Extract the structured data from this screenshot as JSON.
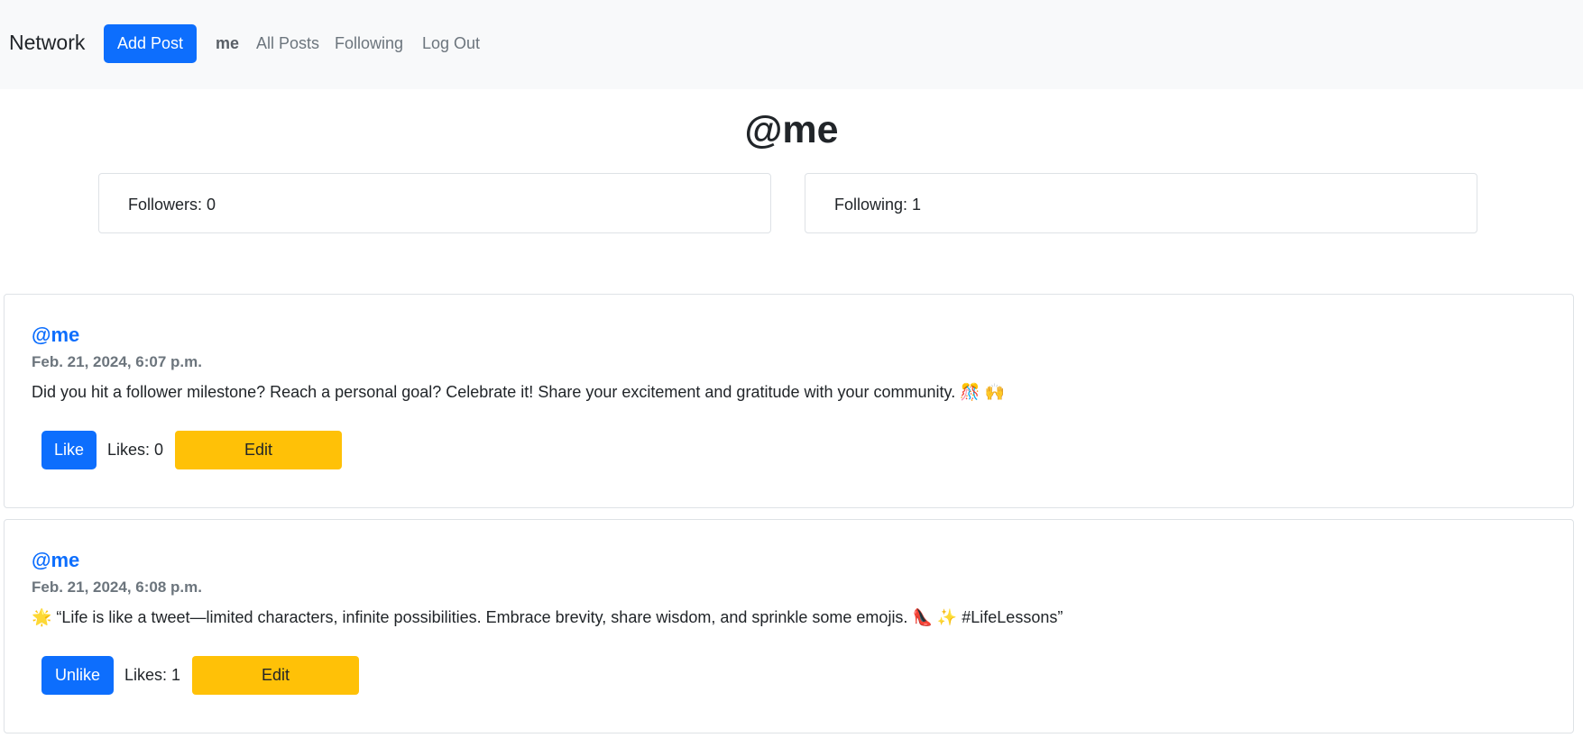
{
  "navbar": {
    "brand": "Network",
    "add_post_label": "Add Post",
    "links": {
      "me": "me",
      "all_posts": "All Posts",
      "following": "Following",
      "log_out": "Log Out"
    }
  },
  "profile": {
    "title": "@me",
    "followers_text": "Followers: 0",
    "following_text": "Following: 1"
  },
  "posts": [
    {
      "user": "@me",
      "date": "Feb. 21, 2024, 6:07 p.m.",
      "content": "Did you hit a follower milestone? Reach a personal goal? Celebrate it! Share your excitement and gratitude with your community. 🎊 🙌",
      "like_label": "Like",
      "likes_text": "Likes: 0",
      "edit_label": "Edit"
    },
    {
      "user": "@me",
      "date": "Feb. 21, 2024, 6:08 p.m.",
      "content": "🌟 “Life is like a tweet—limited characters, infinite possibilities. Embrace brevity, share wisdom, and sprinkle some emojis. 👠 ✨ #LifeLessons”",
      "like_label": "Unlike",
      "likes_text": "Likes: 1",
      "edit_label": "Edit"
    }
  ],
  "colors": {
    "primary": "#0d6efd",
    "warning": "#ffc107",
    "navbar_bg": "#f8f9fa",
    "muted": "#6c757d"
  }
}
